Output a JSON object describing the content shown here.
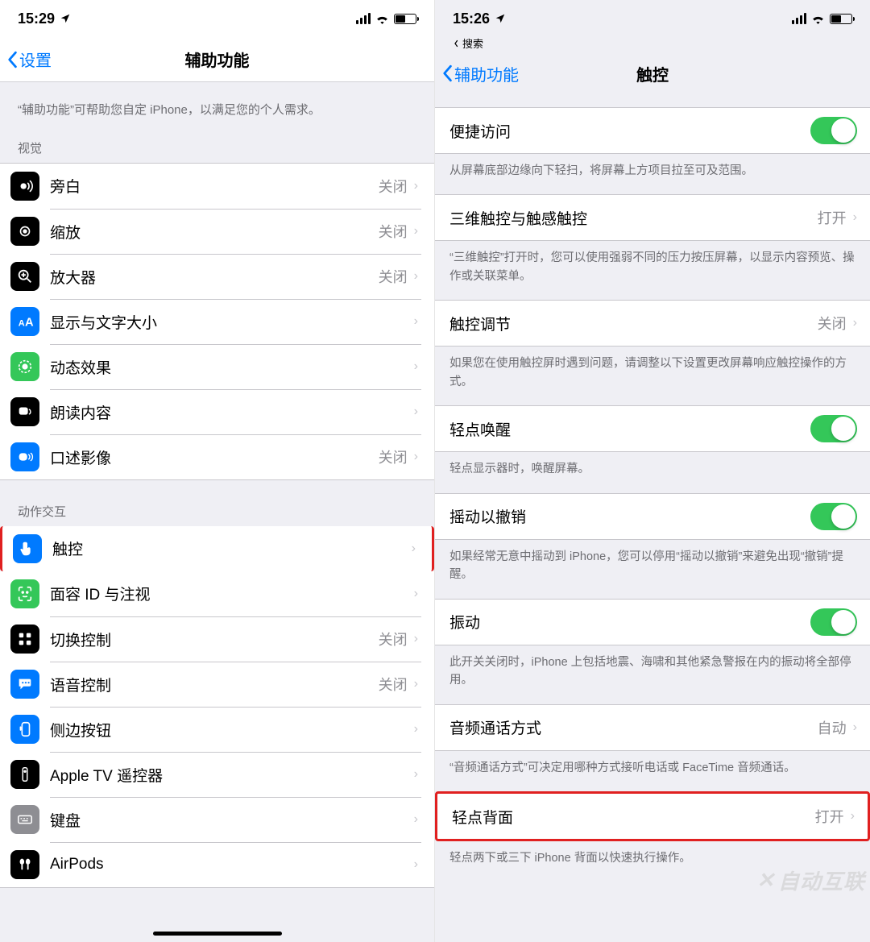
{
  "watermark": "自动互联",
  "left": {
    "status_time": "15:29",
    "back_label": "设置",
    "title": "辅助功能",
    "intro": "“辅助功能”可帮助您自定 iPhone，以满足您的个人需求。",
    "section_vision": "视觉",
    "section_motor": "动作交互",
    "rows_vision": [
      {
        "label": "旁白",
        "value": "关闭"
      },
      {
        "label": "缩放",
        "value": "关闭"
      },
      {
        "label": "放大器",
        "value": "关闭"
      },
      {
        "label": "显示与文字大小",
        "value": ""
      },
      {
        "label": "动态效果",
        "value": ""
      },
      {
        "label": "朗读内容",
        "value": ""
      },
      {
        "label": "口述影像",
        "value": "关闭"
      }
    ],
    "rows_motor": [
      {
        "label": "触控",
        "value": ""
      },
      {
        "label": "面容 ID 与注视",
        "value": ""
      },
      {
        "label": "切换控制",
        "value": "关闭"
      },
      {
        "label": "语音控制",
        "value": "关闭"
      },
      {
        "label": "侧边按钮",
        "value": ""
      },
      {
        "label": "Apple TV 遥控器",
        "value": ""
      },
      {
        "label": "键盘",
        "value": ""
      },
      {
        "label": "AirPods",
        "value": ""
      }
    ]
  },
  "right": {
    "status_time": "15:26",
    "breadcrumb": "搜索",
    "back_label": "辅助功能",
    "title": "触控",
    "groups": [
      {
        "rows": [
          {
            "label": "便捷访问",
            "switch": true
          }
        ],
        "footer": "从屏幕底部边缘向下轻扫，将屏幕上方项目拉至可及范围。"
      },
      {
        "rows": [
          {
            "label": "三维触控与触感触控",
            "value": "打开"
          }
        ],
        "footer": "“三维触控”打开时，您可以使用强弱不同的压力按压屏幕，以显示内容预览、操作或关联菜单。"
      },
      {
        "rows": [
          {
            "label": "触控调节",
            "value": "关闭"
          }
        ],
        "footer": "如果您在使用触控屏时遇到问题，请调整以下设置更改屏幕响应触控操作的方式。"
      },
      {
        "rows": [
          {
            "label": "轻点唤醒",
            "switch": true
          }
        ],
        "footer": "轻点显示器时，唤醒屏幕。"
      },
      {
        "rows": [
          {
            "label": "摇动以撤销",
            "switch": true
          }
        ],
        "footer": "如果经常无意中摇动到 iPhone，您可以停用“摇动以撤销”来避免出现“撤销”提醒。"
      },
      {
        "rows": [
          {
            "label": "振动",
            "switch": true
          }
        ],
        "footer": "此开关关闭时，iPhone 上包括地震、海啸和其他紧急警报在内的振动将全部停用。"
      },
      {
        "rows": [
          {
            "label": "音频通话方式",
            "value": "自动"
          }
        ],
        "footer": "“音频通话方式”可决定用哪种方式接听电话或 FaceTime 音频通话。"
      },
      {
        "rows": [
          {
            "label": "轻点背面",
            "value": "打开"
          }
        ],
        "footer": "轻点两下或三下 iPhone 背面以快速执行操作。"
      }
    ]
  }
}
